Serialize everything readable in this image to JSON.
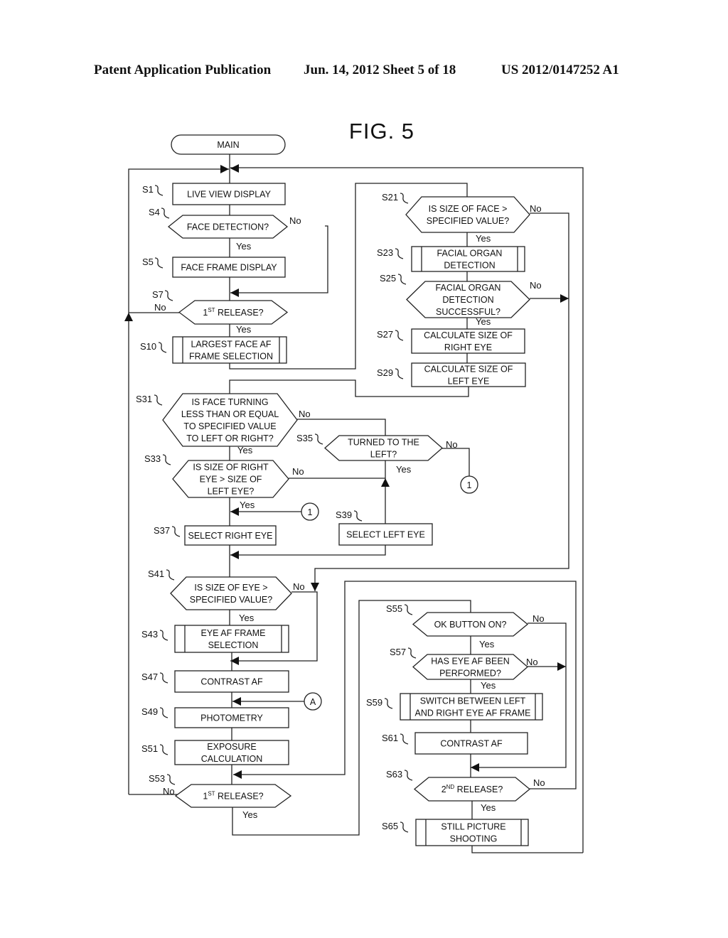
{
  "header": {
    "left": "Patent Application Publication",
    "center": "Jun. 14, 2012  Sheet 5 of 18",
    "right": "US 2012/0147252 A1"
  },
  "figure": {
    "title": "FIG. 5",
    "start_label": "MAIN",
    "yes_label": "Yes",
    "no_label": "No",
    "steps": {
      "S1": {
        "id": "S1",
        "type": "process",
        "lines": [
          "LIVE VIEW DISPLAY"
        ]
      },
      "S4": {
        "id": "S4",
        "type": "decision",
        "lines": [
          "FACE DETECTION?"
        ]
      },
      "S5": {
        "id": "S5",
        "type": "process",
        "lines": [
          "FACE FRAME DISPLAY"
        ]
      },
      "S7": {
        "id": "S7",
        "type": "decision",
        "lines": [
          "1ST RELEASE?"
        ],
        "sup": {
          "base": "1",
          "sup": "ST",
          "rest": " RELEASE?"
        }
      },
      "S10": {
        "id": "S10",
        "type": "subroutine",
        "lines": [
          "LARGEST FACE AF",
          "FRAME SELECTION"
        ]
      },
      "S21": {
        "id": "S21",
        "type": "decision",
        "lines": [
          "IS SIZE OF FACE >",
          "SPECIFIED VALUE?"
        ]
      },
      "S23": {
        "id": "S23",
        "type": "subroutine",
        "lines": [
          "FACIAL ORGAN",
          "DETECTION"
        ]
      },
      "S25": {
        "id": "S25",
        "type": "decision",
        "lines": [
          "FACIAL ORGAN",
          "DETECTION",
          "SUCCESSFUL?"
        ]
      },
      "S27": {
        "id": "S27",
        "type": "process",
        "lines": [
          "CALCULATE SIZE OF",
          "RIGHT EYE"
        ]
      },
      "S29": {
        "id": "S29",
        "type": "process",
        "lines": [
          "CALCULATE SIZE OF",
          "LEFT EYE"
        ]
      },
      "S31": {
        "id": "S31",
        "type": "decision",
        "lines": [
          "IS FACE TURNING",
          "LESS THAN OR EQUAL",
          "TO SPECIFIED VALUE",
          "TO LEFT OR RIGHT?"
        ]
      },
      "S33": {
        "id": "S33",
        "type": "decision",
        "lines": [
          "IS SIZE OF RIGHT",
          "EYE > SIZE OF",
          "LEFT EYE?"
        ]
      },
      "S35": {
        "id": "S35",
        "type": "decision",
        "lines": [
          "TURNED TO THE",
          "LEFT?"
        ]
      },
      "S37": {
        "id": "S37",
        "type": "process",
        "lines": [
          "SELECT RIGHT EYE"
        ]
      },
      "S39": {
        "id": "S39",
        "type": "process",
        "lines": [
          "SELECT LEFT EYE"
        ]
      },
      "S41": {
        "id": "S41",
        "type": "decision",
        "lines": [
          "IS SIZE OF EYE >",
          "SPECIFIED VALUE?"
        ]
      },
      "S43": {
        "id": "S43",
        "type": "subroutine",
        "lines": [
          "EYE AF FRAME",
          "SELECTION"
        ]
      },
      "S47": {
        "id": "S47",
        "type": "process",
        "lines": [
          "CONTRAST AF"
        ]
      },
      "S49": {
        "id": "S49",
        "type": "process",
        "lines": [
          "PHOTOMETRY"
        ]
      },
      "S51": {
        "id": "S51",
        "type": "process",
        "lines": [
          "EXPOSURE",
          "CALCULATION"
        ]
      },
      "S53": {
        "id": "S53",
        "type": "decision",
        "lines": [
          "1ST RELEASE?"
        ],
        "sup": {
          "base": "1",
          "sup": "ST",
          "rest": " RELEASE?"
        }
      },
      "S55": {
        "id": "S55",
        "type": "decision",
        "lines": [
          "OK BUTTON ON?"
        ]
      },
      "S57": {
        "id": "S57",
        "type": "decision",
        "lines": [
          "HAS EYE AF BEEN",
          "PERFORMED?"
        ]
      },
      "S59": {
        "id": "S59",
        "type": "subroutine",
        "lines": [
          "SWITCH BETWEEN LEFT",
          "AND RIGHT EYE AF FRAME"
        ]
      },
      "S61": {
        "id": "S61",
        "type": "process",
        "lines": [
          "CONTRAST AF"
        ]
      },
      "S63": {
        "id": "S63",
        "type": "decision",
        "lines": [
          "2ND RELEASE?"
        ],
        "sup": {
          "base": "2",
          "sup": "ND",
          "rest": " RELEASE?"
        }
      },
      "S65": {
        "id": "S65",
        "type": "subroutine",
        "lines": [
          "STILL PICTURE",
          "SHOOTING"
        ]
      }
    },
    "connectors": {
      "one": "1",
      "a": "A"
    }
  }
}
